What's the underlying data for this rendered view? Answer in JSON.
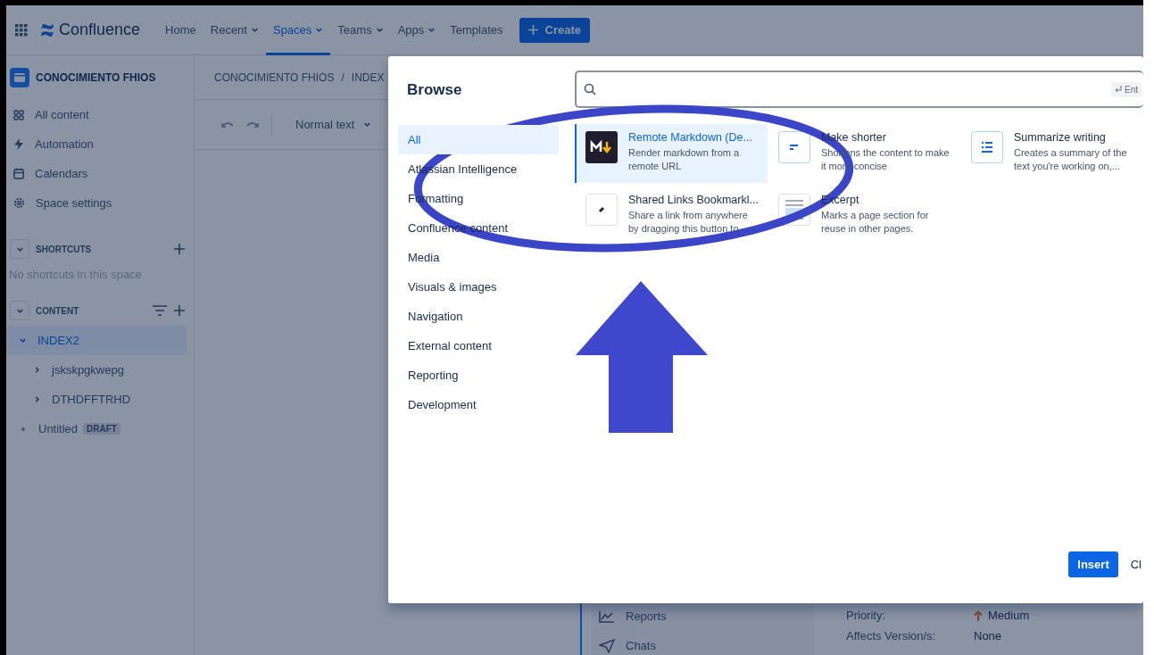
{
  "nav": {
    "logo": "Confluence",
    "create": "Create",
    "items": [
      {
        "label": "Home",
        "dropdown": false,
        "selected": false
      },
      {
        "label": "Recent",
        "dropdown": true,
        "selected": false
      },
      {
        "label": "Spaces",
        "dropdown": true,
        "selected": true
      },
      {
        "label": "Teams",
        "dropdown": true,
        "selected": false
      },
      {
        "label": "Apps",
        "dropdown": true,
        "selected": false
      },
      {
        "label": "Templates",
        "dropdown": false,
        "selected": false
      }
    ]
  },
  "sidebar": {
    "space": "CONOCIMIENTO FHIOS",
    "items": [
      {
        "label": "All content",
        "kind": "grid"
      },
      {
        "label": "Automation",
        "kind": "bolt"
      },
      {
        "label": "Calendars",
        "kind": "calendar"
      },
      {
        "label": "Space settings",
        "kind": "gear"
      }
    ],
    "shortcuts": {
      "title": "SHORTCUTS",
      "empty": "No shortcuts in this space"
    },
    "content": {
      "title": "CONTENT",
      "tree": [
        {
          "label": "INDEX2",
          "selected": true,
          "expanded": true,
          "children": [
            {
              "label": "jskskpgkwepg",
              "selected": false,
              "expanded": false
            },
            {
              "label": "DTHDFFTRHD",
              "selected": false,
              "expanded": false
            }
          ]
        },
        {
          "label": "Untitled",
          "selected": false,
          "badge": "DRAFT"
        }
      ]
    }
  },
  "main": {
    "breadcrumb": [
      "CONOCIMIENTO FHIOS",
      "INDEX"
    ],
    "breadcrumb_separator": "/",
    "text_style": "Normal text",
    "panel": {
      "nav": [
        {
          "label": "Reports",
          "kind": "chart"
        },
        {
          "label": "Chats",
          "kind": "send"
        }
      ],
      "fields": [
        {
          "label": "Priority:",
          "value": "Medium",
          "kind": "priority"
        },
        {
          "label": "Affects Version/s:",
          "value": "None",
          "kind": "plain"
        }
      ]
    }
  },
  "modal": {
    "title": "Browse",
    "search_hint": "Ent",
    "categories": [
      {
        "label": "All",
        "selected": true
      },
      {
        "label": "Atlassian Intelligence",
        "selected": false
      },
      {
        "label": "Formatting",
        "selected": false
      },
      {
        "label": "Confluence content",
        "selected": false
      },
      {
        "label": "Media",
        "selected": false
      },
      {
        "label": "Visuals & images",
        "selected": false
      },
      {
        "label": "Navigation",
        "selected": false
      },
      {
        "label": "External content",
        "selected": false
      },
      {
        "label": "Reporting",
        "selected": false
      },
      {
        "label": "Development",
        "selected": false
      }
    ],
    "results": [
      {
        "title": "Remote Markdown (De...",
        "description": "Render markdown from a remote URL",
        "kind": "markdown",
        "selected": true
      },
      {
        "title": "Make shorter",
        "description": "Shortens the content to make it more concise",
        "kind": "shorten",
        "selected": false
      },
      {
        "title": "Summarize writing",
        "description": "Creates a summary of the text you're working on,...",
        "kind": "summarize",
        "selected": false
      },
      {
        "title": "Shared Links Bookmarkl...",
        "description": "Share a link from anywhere by dragging this button to",
        "kind": "bookmarklet",
        "selected": false
      },
      {
        "title": "Excerpt",
        "description": "Marks a page section for reuse in other pages.",
        "kind": "excerpt",
        "selected": false
      }
    ],
    "insert": "Insert",
    "close": "Cl"
  }
}
